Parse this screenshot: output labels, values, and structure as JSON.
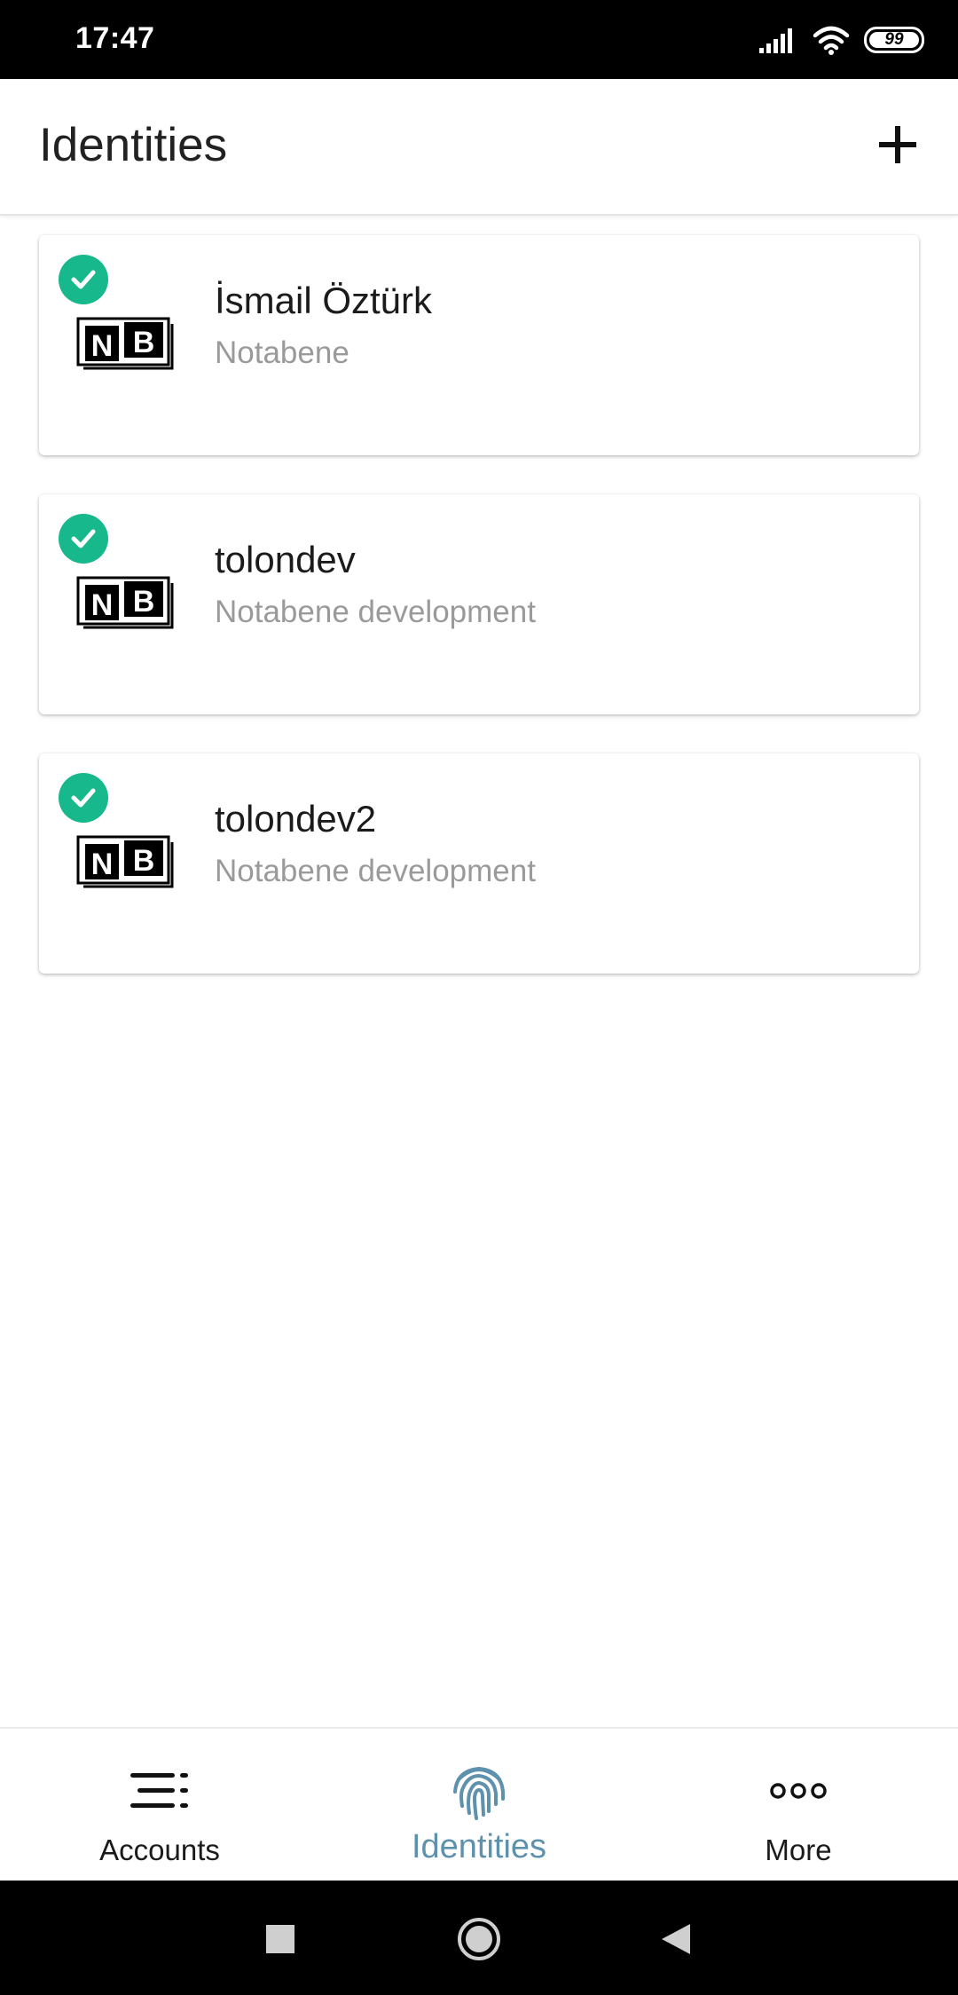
{
  "status_bar": {
    "time": "17:47",
    "battery": "99",
    "icons": [
      "signal-icon",
      "wifi-icon",
      "battery-icon"
    ]
  },
  "header": {
    "title": "Identities",
    "add_icon": "plus-icon"
  },
  "identities": [
    {
      "name": "İsmail Öztürk",
      "issuer": "Notabene",
      "verified": true
    },
    {
      "name": "tolondev",
      "issuer": "Notabene development",
      "verified": true
    },
    {
      "name": "tolondev2",
      "issuer": "Notabene development",
      "verified": true
    }
  ],
  "bottom_nav": {
    "items": [
      {
        "label": "Accounts",
        "icon": "accounts-list-icon",
        "active": false
      },
      {
        "label": "Identities",
        "icon": "fingerprint-icon",
        "active": true
      },
      {
        "label": "More",
        "icon": "more-dots-icon",
        "active": false
      }
    ]
  },
  "system_nav": [
    "recents-square-icon",
    "home-circle-icon",
    "back-triangle-icon"
  ],
  "colors": {
    "accent": "#5e91ad",
    "verified": "#16b88c",
    "subtitle": "#9a9a9a"
  }
}
